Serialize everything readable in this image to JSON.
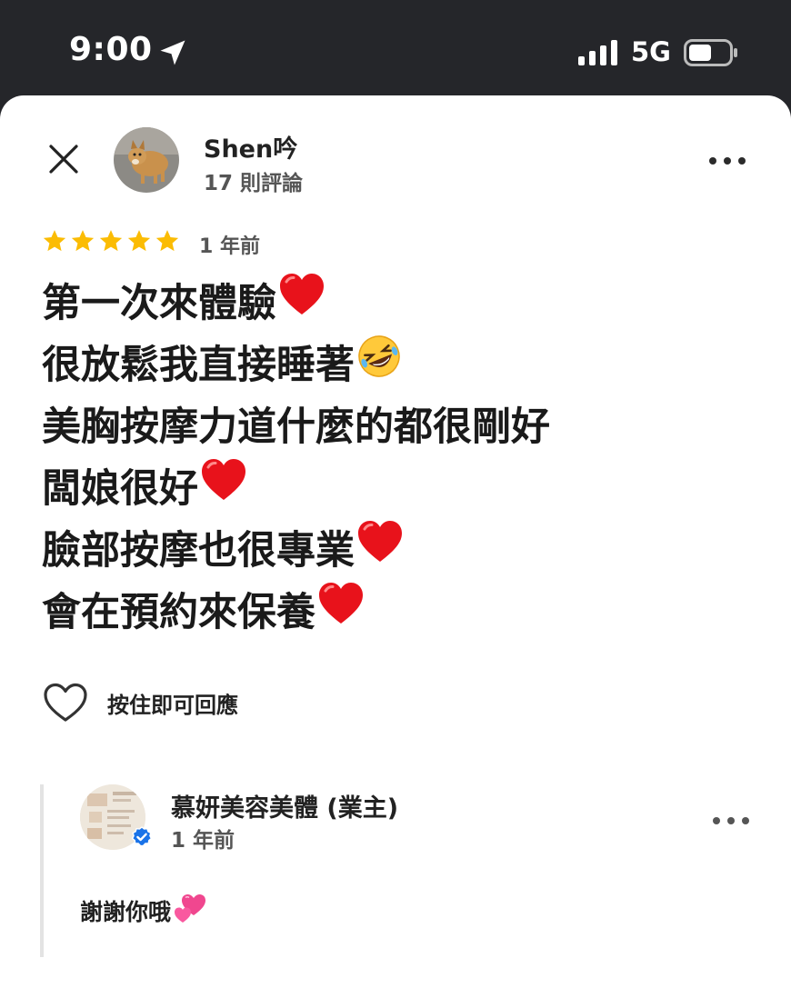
{
  "status_bar": {
    "time": "9:00",
    "network": "5G"
  },
  "review": {
    "reviewer_name": "Shen吟",
    "review_count": "17 則評論",
    "rating": 5,
    "date": "1 年前",
    "lines": [
      {
        "text": "第一次來體驗",
        "emoji": "red-heart-icon"
      },
      {
        "text": "很放鬆我直接睡著",
        "emoji": "rolling-laughing-icon"
      },
      {
        "text": "美胸按摩力道什麼的都很剛好",
        "emoji": ""
      },
      {
        "text": "闆娘很好",
        "emoji": "red-heart-icon"
      },
      {
        "text": "臉部按摩也很專業",
        "emoji": "red-heart-icon"
      },
      {
        "text": "會在預約來保養",
        "emoji": "red-heart-icon"
      }
    ],
    "react_label": "按住即可回應"
  },
  "owner_reply": {
    "name": "慕妍美容美體 (業主)",
    "date": "1 年前",
    "text": "謝謝你哦",
    "emoji": "two-hearts-icon"
  },
  "colors": {
    "star": "#fbbc04",
    "heart": "#e8121b",
    "verified": "#1a73e8",
    "status_bar_bg": "#25262a"
  }
}
